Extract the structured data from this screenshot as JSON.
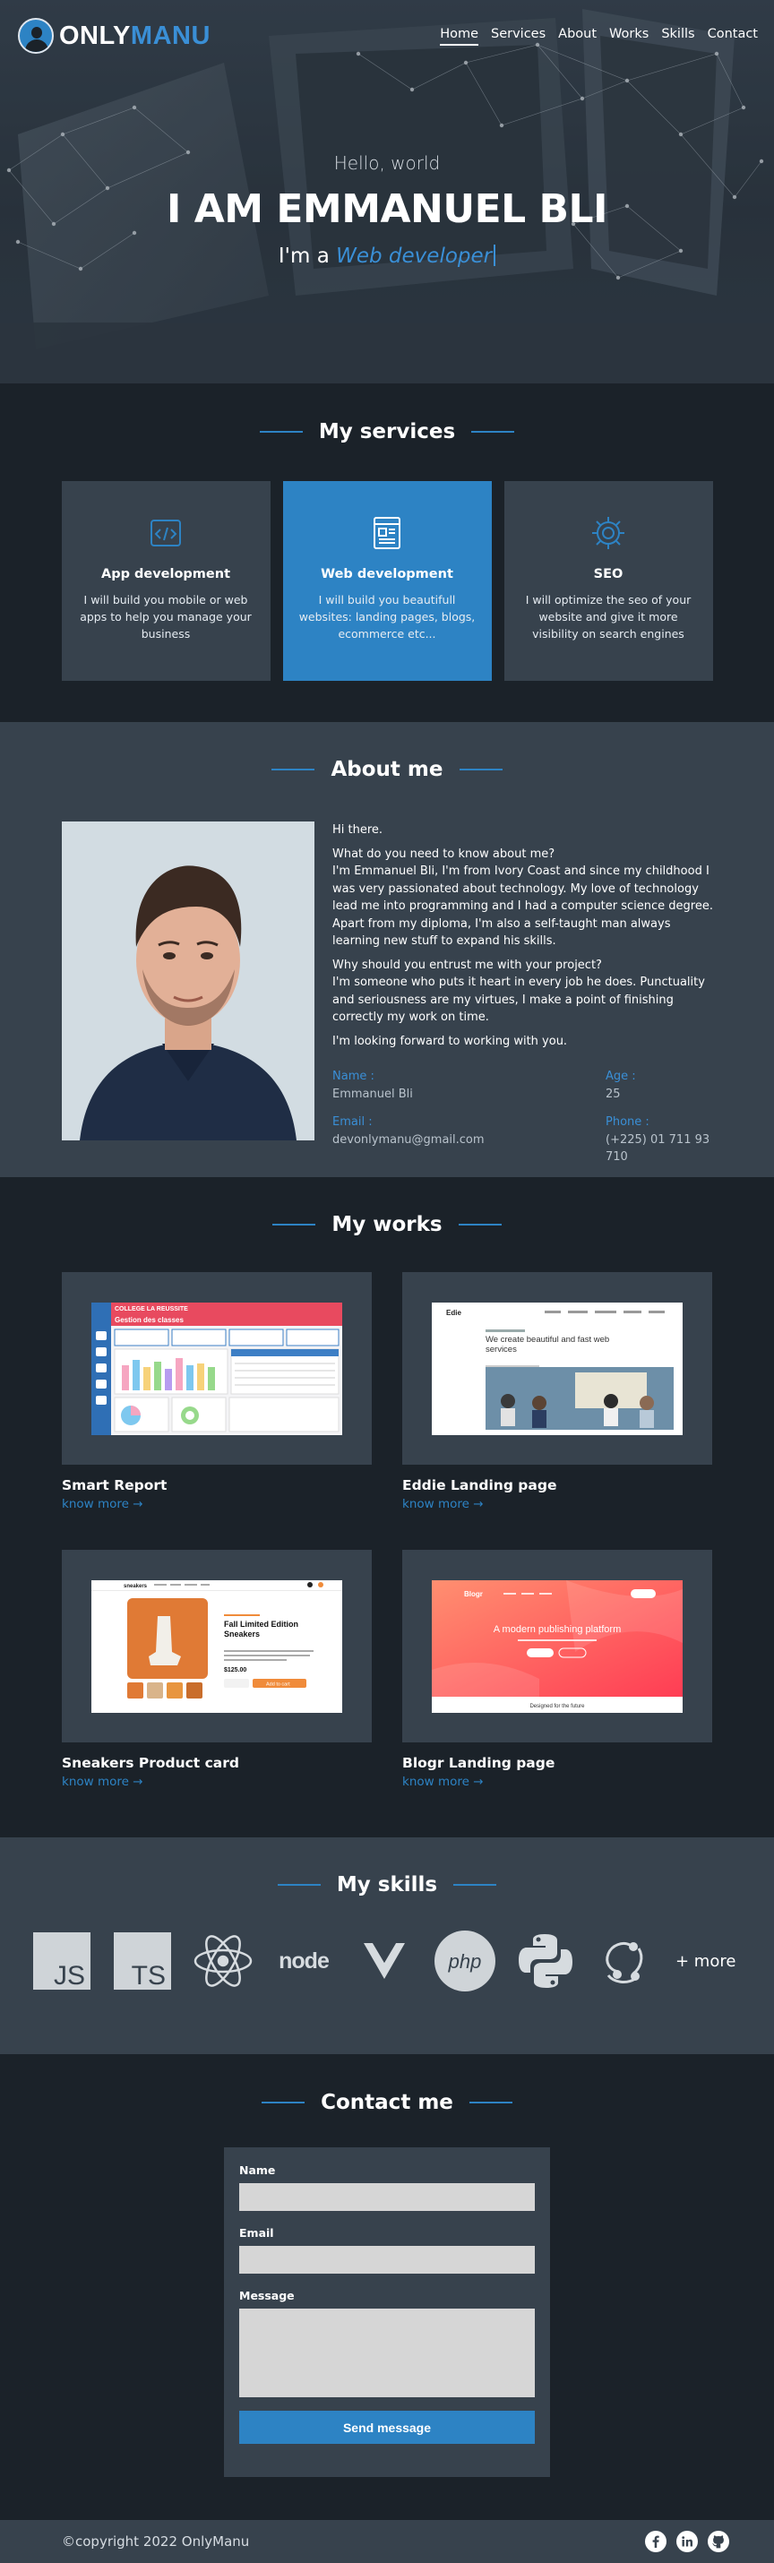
{
  "nav": {
    "brand_part1": "ONLY",
    "brand_part2": "MANU",
    "links": [
      "Home",
      "Services",
      "About",
      "Works",
      "Skills",
      "Contact"
    ]
  },
  "hero": {
    "greeting": "Hello, world",
    "name": "I AM EMMANUEL BLI",
    "role_prefix": "I'm a ",
    "role_typed": "Web developer"
  },
  "services": {
    "title": "My services",
    "items": [
      {
        "icon": "code-icon",
        "title": "App development",
        "desc": "I will build you mobile or web apps to help you manage your business"
      },
      {
        "icon": "web-page-icon",
        "title": "Web development",
        "desc": "I will build you beautifull websites: landing pages, blogs, ecommerce etc..."
      },
      {
        "icon": "seo-icon",
        "title": "SEO",
        "desc": "I will optimize the seo of your website and give it more visibility on search engines"
      }
    ]
  },
  "about": {
    "title": "About me",
    "paragraphs": [
      "Hi there.",
      "What do you need to know about me?\nI'm Emmanuel Bli, I'm from Ivory Coast and since my childhood I was very passionated about technology. My love of technology lead me into programming and I had a computer science degree. Apart from my diploma, I'm also a self-taught man always learning new stuff to expand his skills.",
      "Why should you entrust me with your project?\nI'm someone who puts it heart in every job he does. Punctuality and seriousness are my virtues, I make a point of finishing correctly my work on time.",
      "I'm looking forward to working with you."
    ],
    "info": {
      "name_label": "Name :",
      "name_value": "Emmanuel Bli",
      "age_label": "Age :",
      "age_value": "25",
      "email_label": "Email :",
      "email_value": "devonlymanu@gmail.com",
      "phone_label": "Phone :",
      "phone_value": "(+225) 01 711 93 710"
    }
  },
  "works": {
    "title": "My works",
    "link_label": "know more →",
    "items": [
      {
        "title": "Smart Report"
      },
      {
        "title": "Eddie Landing page"
      },
      {
        "title": "Sneakers Product card"
      },
      {
        "title": "Blogr Landing page"
      }
    ],
    "eddie": {
      "brand": "Edie",
      "headline": "We create beautiful and fast web services"
    },
    "sneakers": {
      "brand": "sneakers",
      "headline": "Fall Limited Edition Sneakers",
      "price": "$125.00",
      "cart": "Add to cart"
    },
    "blogr": {
      "brand": "Blogr",
      "headline": "A modern publishing platform",
      "footer": "Designed for the future"
    },
    "smart": {
      "header": "COLLEGE LA REUSSITE",
      "subheader": "Gestion des classes"
    }
  },
  "skills": {
    "title": "My skills",
    "items": [
      "JS",
      "TS",
      "react-icon",
      "node",
      "vue-icon",
      "php",
      "python-icon",
      "redux-icon"
    ],
    "more": "+ more"
  },
  "contact": {
    "title": "Contact me",
    "name_label": "Name",
    "email_label": "Email",
    "message_label": "Message",
    "submit": "Send message"
  },
  "footer": {
    "copyright": "©copyright 2022 OnlyManu",
    "socials": [
      "facebook-icon",
      "linkedin-icon",
      "github-icon"
    ]
  },
  "colors": {
    "accent": "#2d83c4",
    "dark_bg": "#1b2229",
    "card_bg": "#37424d"
  }
}
